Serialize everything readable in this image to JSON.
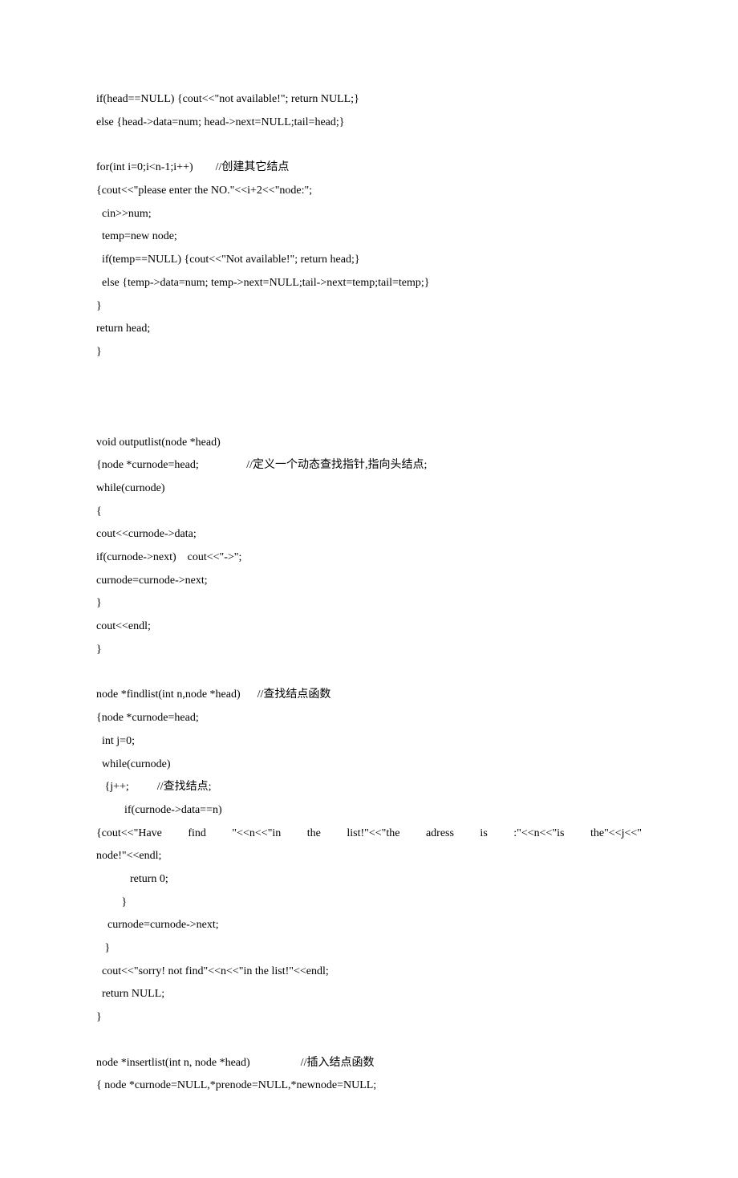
{
  "lines": [
    {
      "t": "if(head==NULL) {cout<<\"not available!\"; return NULL;}"
    },
    {
      "t": "else {head->data=num; head->next=NULL;tail=head;}"
    },
    {
      "t": ""
    },
    {
      "t": "for(int i=0;i<n-1;i++)        //创建其它结点"
    },
    {
      "t": "{cout<<\"please enter the NO.\"<<i+2<<\"node:\";"
    },
    {
      "t": "  cin>>num;"
    },
    {
      "t": "  temp=new node;"
    },
    {
      "t": "  if(temp==NULL) {cout<<\"Not available!\"; return head;}"
    },
    {
      "t": "  else {temp->data=num; temp->next=NULL;tail->next=temp;tail=temp;}"
    },
    {
      "t": "}"
    },
    {
      "t": "return head;"
    },
    {
      "t": "}"
    },
    {
      "t": ""
    },
    {
      "t": ""
    },
    {
      "t": ""
    },
    {
      "t": "void outputlist(node *head)"
    },
    {
      "t": "{node *curnode=head;                 //定义一个动态查找指针,指向头结点;"
    },
    {
      "t": "while(curnode)"
    },
    {
      "t": "{"
    },
    {
      "t": "cout<<curnode->data;"
    },
    {
      "t": "if(curnode->next)    cout<<\"->\";"
    },
    {
      "t": "curnode=curnode->next;"
    },
    {
      "t": "}"
    },
    {
      "t": "cout<<endl;"
    },
    {
      "t": "}"
    },
    {
      "t": ""
    },
    {
      "t": "node *findlist(int n,node *head)      //查找结点函数"
    },
    {
      "t": "{node *curnode=head;"
    },
    {
      "t": "  int j=0;"
    },
    {
      "t": "  while(curnode)"
    },
    {
      "t": "   {j++;          //查找结点;"
    },
    {
      "t": "          if(curnode->data==n)"
    },
    {
      "t": "         {cout<<\"Have   find   \"<<n<<\"in   the   list!\"<<\"the   adress   is   :\"<<n<<\"is   the\"<<j<<\"",
      "justify": true
    },
    {
      "t": "node!\"<<endl;"
    },
    {
      "t": "            return 0;"
    },
    {
      "t": "         }"
    },
    {
      "t": "    curnode=curnode->next;"
    },
    {
      "t": "   }"
    },
    {
      "t": "  cout<<\"sorry! not find\"<<n<<\"in the list!\"<<endl;"
    },
    {
      "t": "  return NULL;"
    },
    {
      "t": "}"
    },
    {
      "t": ""
    },
    {
      "t": "node *insertlist(int n, node *head)                  //插入结点函数"
    },
    {
      "t": "{ node *curnode=NULL,*prenode=NULL,*newnode=NULL;"
    }
  ]
}
